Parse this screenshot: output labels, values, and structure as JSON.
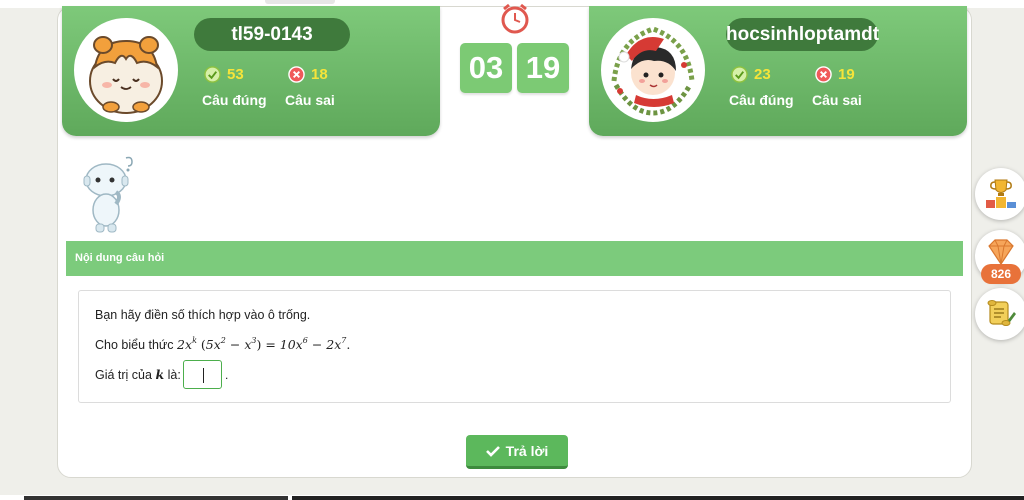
{
  "players": [
    {
      "name": "tl59-0143",
      "correct_count": "53",
      "wrong_count": "18",
      "correct_label": "Câu đúng",
      "wrong_label": "Câu sai",
      "avatar_icon": "hamster-avatar"
    },
    {
      "name": "hocsinhloptamdt",
      "correct_count": "23",
      "wrong_count": "19",
      "correct_label": "Câu đúng",
      "wrong_label": "Câu sai",
      "avatar_icon": "christmas-boy-avatar"
    }
  ],
  "timer": {
    "minutes": "03",
    "seconds": "19",
    "icon": "alarm-clock-icon"
  },
  "question": {
    "header": "Nội dung câu hỏi",
    "instruction": "Bạn hãy điền số thích hợp vào ô trống.",
    "expression_prefix": "Cho biểu thức",
    "value_prefix": "Giá trị của",
    "value_var": "k",
    "value_suffix": "là:",
    "answer_value": ""
  },
  "submit_label": "Trả lời",
  "side_panel": {
    "gem_count": "826"
  },
  "colors": {
    "accent": "#5cb85c",
    "panel": "#6fb86b",
    "name_pill": "#3f7a3c",
    "score": "#f6e43a",
    "gem_badge": "#e8723a"
  }
}
